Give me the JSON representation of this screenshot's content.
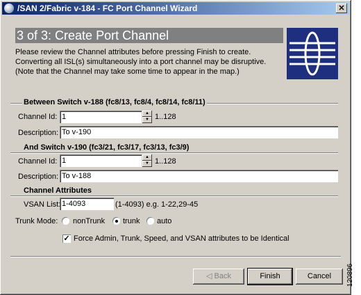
{
  "window": {
    "title": "/SAN 2/Fabric v-184 - FC Port Channel Wizard",
    "close_label": "✕"
  },
  "header": {
    "step_title": "3 of 3: Create Port Channel",
    "intro": "Please review the Channel attributes before pressing Finish to create. Converting all ISL(s) simultaneously into a port channel may be disruptive. (Note that the Channel may take some time to appear in the map.)"
  },
  "switch_a": {
    "heading": "Between Switch v-188 (fc8/13, fc8/4, fc8/14, fc8/11)",
    "channel_id_label": "Channel Id:",
    "channel_id_value": "1",
    "range_hint": "1..128",
    "description_label": "Description:",
    "description_value": "To v-190"
  },
  "switch_b": {
    "heading": "And Switch v-190 (fc3/21, fc3/17, fc3/13, fc3/9)",
    "channel_id_label": "Channel Id:",
    "channel_id_value": "1",
    "range_hint": "1..128",
    "description_label": "Description:",
    "description_value": "To v-188"
  },
  "attributes": {
    "heading": "Channel Attributes",
    "vsan_label": "VSAN List:",
    "vsan_value": "1-4093",
    "vsan_hint": "(1-4093) e.g. 1-22,29-45",
    "trunk_label": "Trunk Mode:",
    "trunk_options": [
      "nonTrunk",
      "trunk",
      "auto"
    ],
    "trunk_selected": "trunk",
    "force_label": "Force Admin, Trunk, Speed, and VSAN attributes to be Identical",
    "force_checked": true
  },
  "buttons": {
    "back": "Back",
    "finish": "Finish",
    "cancel": "Cancel"
  },
  "side_number": "120896",
  "icons": [
    "app-icon",
    "close-icon",
    "wizard-logo-icon",
    "spin-up-icon",
    "spin-down-icon",
    "back-arrow-icon"
  ]
}
